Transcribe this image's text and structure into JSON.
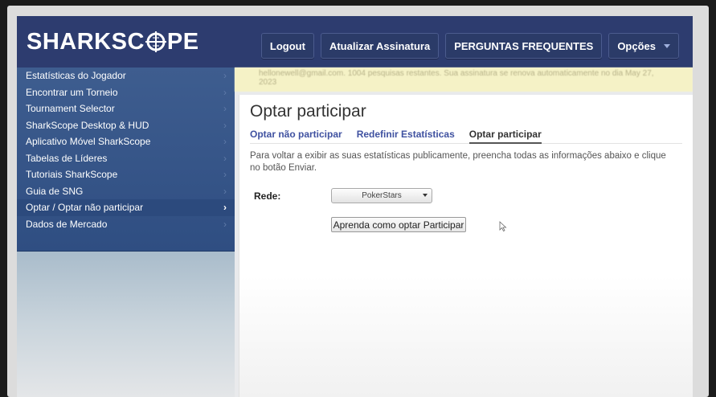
{
  "brand": {
    "logo_text_left": "SHARKSC",
    "logo_text_right": "PE",
    "colors": {
      "header": "#2d3c6f",
      "sidebar": "#3e5d8f",
      "link": "#3f51a0",
      "notice": "#f5f2c6"
    }
  },
  "nav": {
    "logout": "Logout",
    "update_subscription": "Atualizar Assinatura",
    "faq": "PERGUNTAS FREQUENTES",
    "options": "Opções"
  },
  "sidebar": {
    "items": [
      {
        "label": "Estatísticas do Jogador"
      },
      {
        "label": "Encontrar um Torneio"
      },
      {
        "label": "Tournament Selector"
      },
      {
        "label": "SharkScope Desktop & HUD"
      },
      {
        "label": "Aplicativo Móvel SharkScope"
      },
      {
        "label": "Tabelas de Líderes"
      },
      {
        "label": "Tutoriais SharkScope"
      },
      {
        "label": "Guia de SNG"
      },
      {
        "label": "Optar / Optar não participar"
      },
      {
        "label": "Dados de Mercado"
      }
    ],
    "active_index": 8,
    "chevron": "›"
  },
  "notice": {
    "text": "hellonewell@gmail.com. 1004 pesquisas restantes. Sua assinatura se renova automaticamente no dia May 27, 2023"
  },
  "main": {
    "title": "Optar participar",
    "tabs": [
      {
        "label": "Optar não participar"
      },
      {
        "label": "Redefinir Estatísticas"
      },
      {
        "label": "Optar participar"
      }
    ],
    "description": "Para voltar a exibir as suas estatísticas publicamente, preencha todas as informações abaixo e clique no botão Enviar.",
    "network_label": "Rede:",
    "network_selected": "PokerStars",
    "optin_button": "Aprenda como optar Participar"
  }
}
